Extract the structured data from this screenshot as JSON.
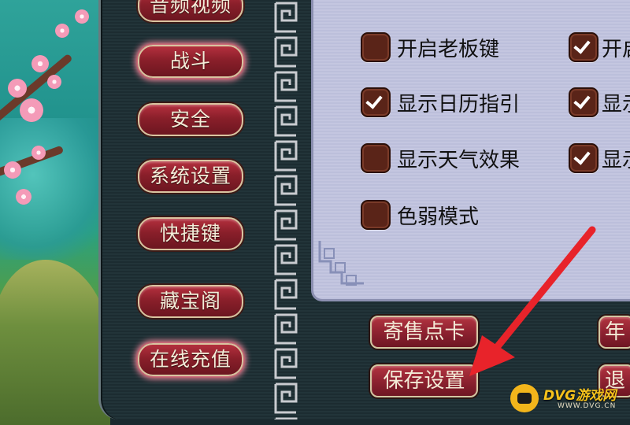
{
  "nav": {
    "items": [
      {
        "label": "音频视频"
      },
      {
        "label": "战斗",
        "active": true
      },
      {
        "label": "安全"
      },
      {
        "label": "系统设置"
      },
      {
        "label": "快捷键"
      },
      {
        "label": "藏宝阁"
      },
      {
        "label": "在线充值"
      }
    ]
  },
  "settings": {
    "options": [
      {
        "label": "开启老板键",
        "checked": false
      },
      {
        "label": "显示日历指引",
        "checked": true
      },
      {
        "label": "显示天气效果",
        "checked": false
      },
      {
        "label": "色弱模式",
        "checked": false
      },
      {
        "label": "开启",
        "checked": true
      },
      {
        "label": "显示",
        "checked": true
      },
      {
        "label": "显示",
        "checked": true
      }
    ]
  },
  "actions": {
    "consign_label": "寄售点卡",
    "save_label": "保存设置",
    "partial1_label": "年",
    "partial2_label": "退"
  },
  "watermark": {
    "brand": "DVG游戏网",
    "url": "WWW.DVG.CN"
  },
  "colors": {
    "button_red": "#8e2230",
    "panel_bg": "#1c2c31",
    "settings_bg": "#c4c6e0",
    "arrow_red": "#e8232a",
    "watermark_gold": "#f3b51b"
  }
}
